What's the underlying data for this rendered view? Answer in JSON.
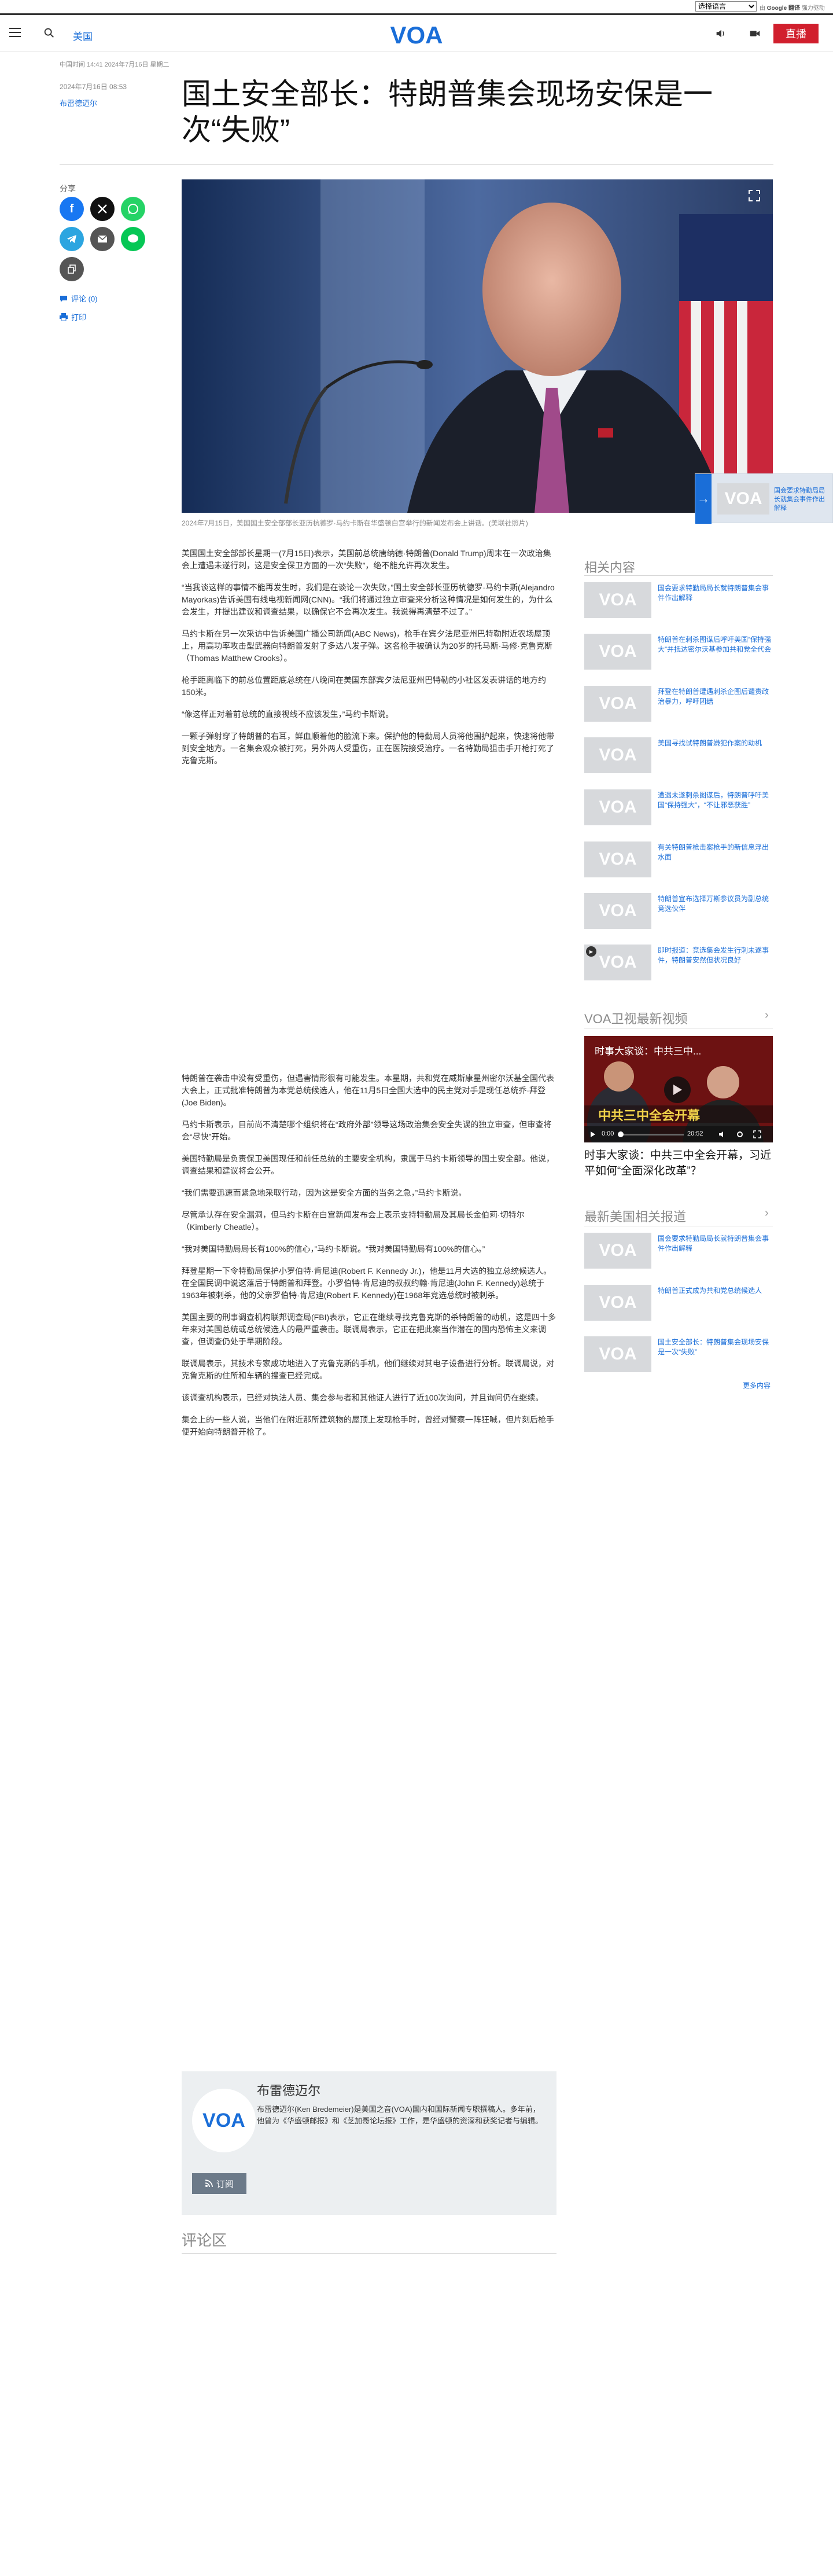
{
  "translate_bar": {
    "select_value": "选择语言",
    "credit_prefix": "由",
    "credit_brand": "Google 翻译",
    "credit_suffix": "强力驱动"
  },
  "header": {
    "section_label": "美国",
    "logo_text": "VOA",
    "live_label": "直播"
  },
  "meta": {
    "updated": "中国时间 14:41 2024年7月16日 星期二",
    "published": "2024年7月16日 08:53",
    "author": "布雷德迈尔"
  },
  "article": {
    "title": "国土安全部长：特朗普集会现场安保是一次“失败”",
    "caption": "2024年7月15日，美国国土安全部部长亚历杭德罗·马约卡斯在华盛顿白宫举行的新闻发布会上讲话。(美联社照片)",
    "paragraphs_a": [
      "美国国土安全部部长星期一(7月15日)表示，美国前总统唐纳德·特朗普(Donald Trump)周末在一次政治集会上遭遇未遂行刺，这是安全保卫方面的一次“失败”，绝不能允许再次发生。",
      "“当我谈这样的事情不能再发生时，我们是在谈论一次失败，”国土安全部长亚历杭德罗·马约卡斯(Alejandro Mayorkas)告诉美国有线电视新闻网(CNN)。“我们将通过独立审查来分析这种情况是如何发生的，为什么会发生，并提出建议和调查结果，以确保它不会再次发生。我说得再清楚不过了。”",
      "马约卡斯在另一次采访中告诉美国广播公司新闻(ABC News)，枪手在宾夕法尼亚州巴特勒附近农场屋顶上，用高功率攻击型武器向特朗普发射了多达八发子弹。这名枪手被确认为20岁的托马斯·马修·克鲁克斯（Thomas Matthew Crooks）。",
      "枪手距离临下的前总位置距底总统在八晚间在美国东部宾夕法尼亚州巴特勒的小社区发表讲话的地方约150米。",
      "“像这样正对着前总统的直接视线不应该发生，”马约卡斯说。",
      "一颗子弹射穿了特朗普的右耳，鲜血顺着他的脸流下来。保护他的特勤局人员将他围护起来，快速将他带到安全地方。一名集会观众被打死，另外两人受重伤，正在医院接受治疗。一名特勤局狙击手开枪打死了克鲁克斯。"
    ],
    "paragraphs_b": [
      "特朗普在袭击中没有受重伤，但遇害情形很有可能发生。本星期，共和党在威斯康星州密尔沃基全国代表大会上，正式批准特朗普为本党总统候选人，他在11月5日全国大选中的民主党对手是现任总统乔·拜登(Joe Biden)。",
      "马约卡斯表示，目前尚不清楚哪个组织将在“政府外部”领导这场政治集会安全失误的独立审查，但审查将会“尽快”开始。",
      "美国特勤局是负责保卫美国现任和前任总统的主要安全机构，隶属于马约卡斯领导的国土安全部。他说，调查结果和建议将会公开。",
      "“我们需要迅速而紧急地采取行动，因为这是安全方面的当务之急，”马约卡斯说。",
      "尽管承认存在安全漏洞，但马约卡斯在白宫新闻发布会上表示支持特勤局及其局长金伯莉·切特尔（Kimberly Cheatle）。",
      "“我对美国特勤局局长有100%的信心，”马约卡斯说。“我对美国特勤局有100%的信心。”",
      "拜登星期一下令特勤局保护小罗伯特·肯尼迪(Robert F. Kennedy Jr.)，他是11月大选的独立总统候选人。在全国民调中说这落后于特朗普和拜登。小罗伯特·肯尼迪的叔叔约翰·肯尼迪(John F. Kennedy)总统于1963年被刺杀，他的父亲罗伯特·肯尼迪(Robert F. Kennedy)在1968年竞选总统时被刺杀。",
      "美国主要的刑事调查机构联邦调查局(FBI)表示，它正在继续寻找克鲁克斯的杀特朗普的动机，这是四十多年来对美国总统或总统候选人的最严重袭击。联调局表示，它正在把此案当作潜在的国内恐怖主义来调查，但调查仍处于早期阶段。",
      "联调局表示，其技术专家成功地进入了克鲁克斯的手机，他们继续对其电子设备进行分析。联调局说，对克鲁克斯的住所和车辆的搜查已经完成。",
      "该调查机构表示，已经对执法人员、集会参与者和其他证人进行了近100次询问，并且询问仍在继续。",
      "集会上的一些人说，当他们在附近那所建筑物的屋顶上发现枪手时，曾经对警察一阵狂喊，但片刻后枪手便开始向特朗普开枪了。"
    ]
  },
  "share": {
    "label": "分享",
    "comments": "评论 (0)",
    "print": "打印"
  },
  "popup": {
    "text": "国会要求特勤局局长就集会事件作出解释"
  },
  "sidebar": {
    "related_heading": "相关内容",
    "related": [
      "国会要求特勤局局长就特朗普集会事件作出解释",
      "特朗普在刺杀图谋后呼吁美国“保持强大”并抵达密尔沃基参加共和党全代会",
      "拜登在特朗普遭遇刺杀企图后谴责政治暴力，呼吁团结",
      "美国寻找试特朗普嫌犯作案的动机",
      "遭遇未遂刺杀图谋后，特朗普呼吁美国“保持强大”，“不让邪恶获胜”",
      "有关特朗普枪击案枪手的新信息浮出水面",
      "特朗普宣布选择万斯参议员为副总统竞选伙伴",
      "即时报道：竞选集会发生行刺未遂事件，特朗普安然但状况良好"
    ],
    "video_heading": "VOA卫视最新视频",
    "video": {
      "overlay_title": "时事大家谈：中共三中...",
      "banner_text": "中共三中全会开幕",
      "time": "0:00",
      "duration": "20:52",
      "title": "时事大家谈：中共三中全会开幕，习近平如何“全面深化改革”？"
    },
    "latest_heading": "最新美国相关报道",
    "latest": [
      "国会要求特勤局局长就特朗普集会事件作出解释",
      "特朗普正式成为共和党总统候选人",
      "国土安全部长：特朗普集会现场安保是一次“失败”"
    ],
    "more_label": "更多内容"
  },
  "author_box": {
    "name": "布雷德迈尔",
    "bio": "布雷德迈尔(Ken Bredemeier)是美国之音(VOA)国内和国际新闻专职撰稿人。多年前，他曾为《华盛顿邮报》和《芝加哥论坛报》工作，是华盛顿的资深和获奖记者与编辑。",
    "subscribe_label": "订阅",
    "logo_text": "VOA"
  },
  "comments_heading": "评论区"
}
